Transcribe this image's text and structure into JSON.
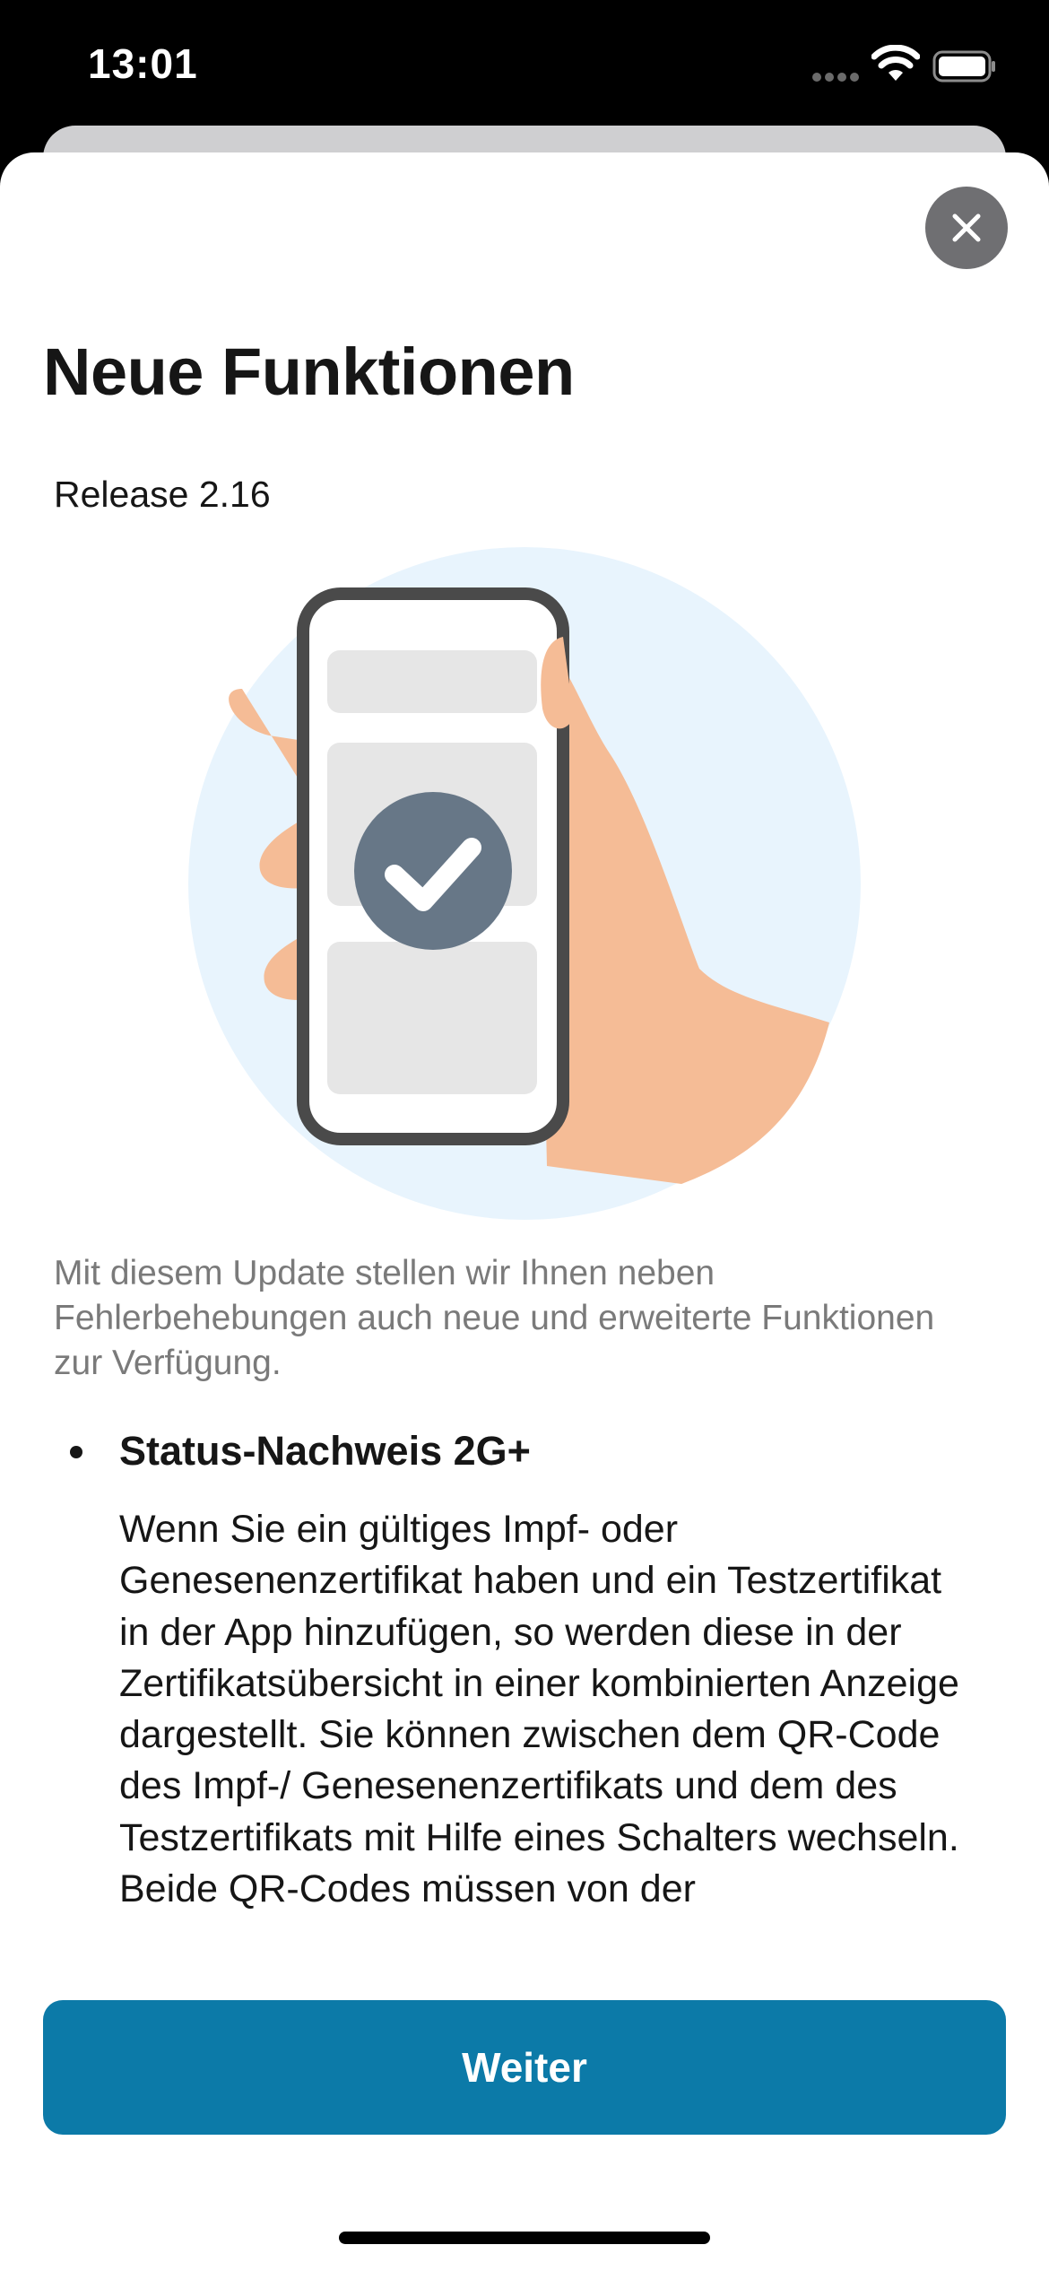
{
  "status_bar": {
    "time": "13:01",
    "icons": [
      "cellular-dots-icon",
      "wifi-icon",
      "battery-icon"
    ]
  },
  "sheet": {
    "close_icon": "close-icon",
    "title": "Neue Funktionen",
    "release": "Release 2.16",
    "illustration": "hand-holding-phone-check-icon",
    "intro": "Mit diesem Update stellen wir Ihnen neben Fehlerbehebungen auch neue und erweiterte Funktionen zur Verfügung.",
    "features": [
      {
        "title": "Status-Nachweis 2G+",
        "body": "Wenn Sie ein gültiges Impf- oder Genesenenzertifikat haben und ein Testzertifikat in der App hinzufügen, so werden diese in der Zertifikatsübersicht in einer kombinierten Anzeige dargestellt. Sie können zwischen dem QR-Code des Impf-/ Genesenenzertifikats und dem des Testzertifikats mit Hilfe eines Schalters wechseln. Beide QR-Codes müssen von der"
      }
    ],
    "continue_label": "Weiter"
  },
  "colors": {
    "primary_button": "#0c7aa8",
    "close_button": "#6f6f72",
    "illustration_circle": "#e8f4fd",
    "skin": "#f5bc96",
    "check_badge": "#677787"
  }
}
